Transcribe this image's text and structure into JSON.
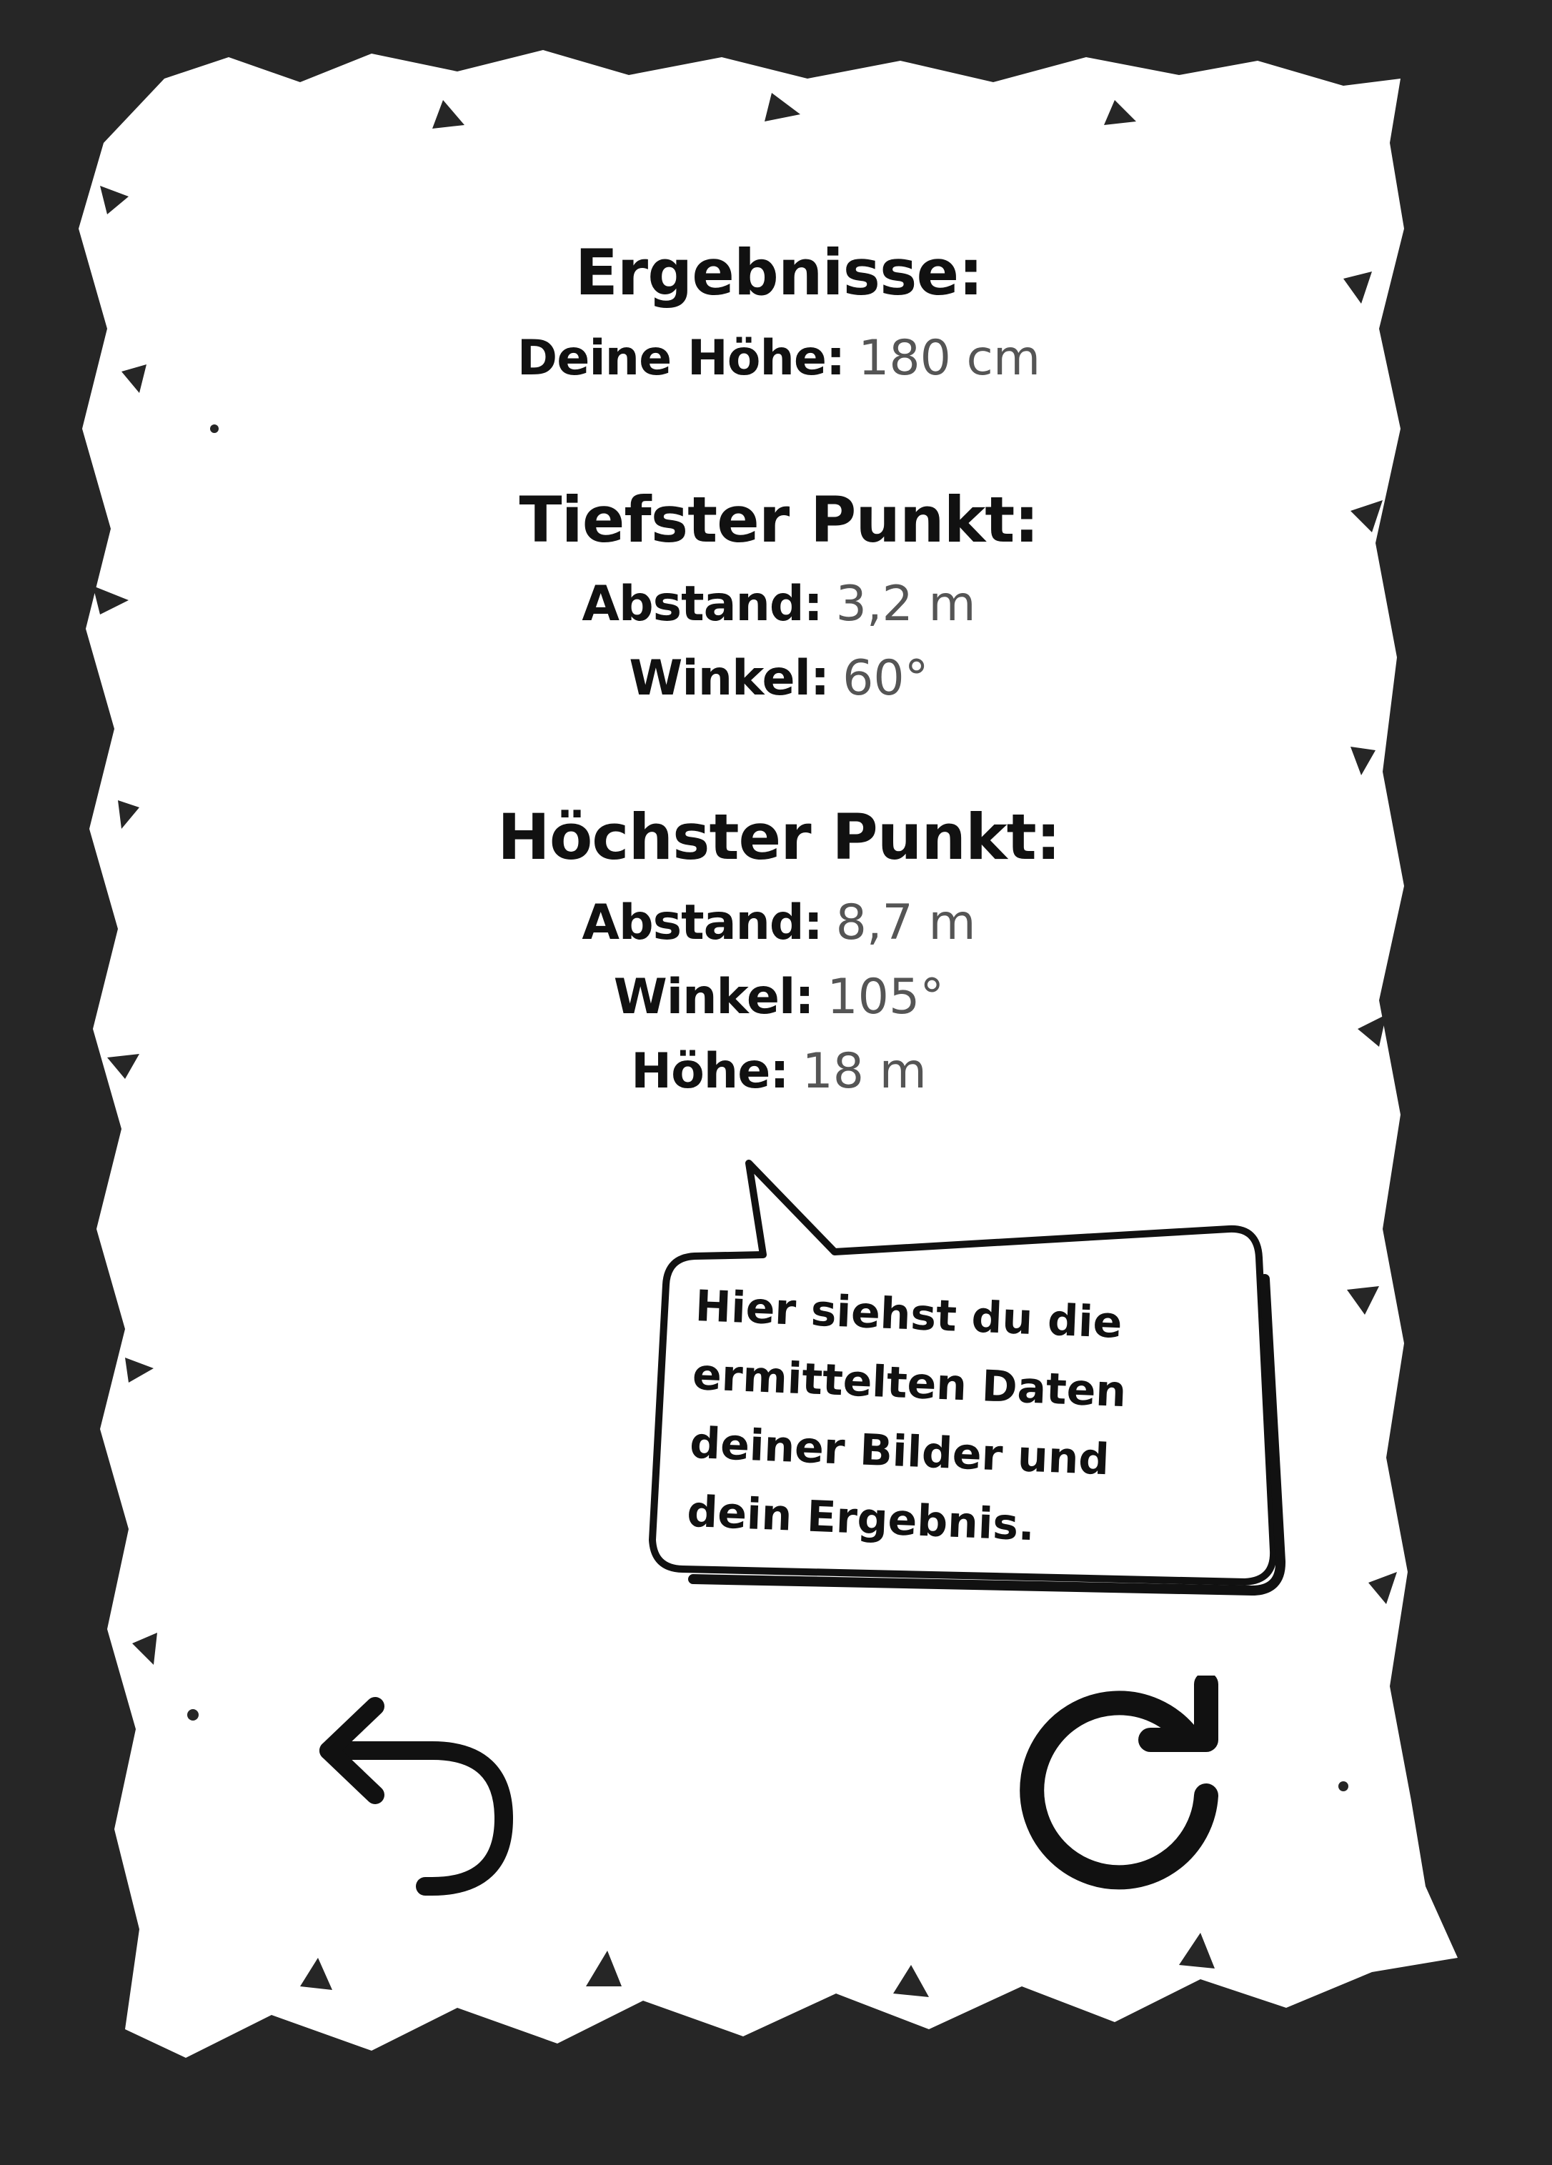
{
  "results": {
    "title": "Ergebnisse:",
    "height_label": "Deine Höhe:",
    "height_value": "180 cm"
  },
  "lowest_point": {
    "title": "Tiefster Punkt:",
    "distance_label": "Abstand:",
    "distance_value": "3,2 m",
    "angle_label": "Winkel:",
    "angle_value": "60°"
  },
  "highest_point": {
    "title": "Höchster Punkt:",
    "distance_label": "Abstand:",
    "distance_value": "8,7 m",
    "angle_label": "Winkel:",
    "angle_value": "105°",
    "height_label": "Höhe:",
    "height_value": "18 m"
  },
  "speech_bubble": {
    "lines": [
      "Hier siehst du die",
      "ermittelten Daten",
      "deiner Bilder und",
      "dein Ergebnis."
    ]
  },
  "icons": {
    "back": "undo-arrow-icon",
    "restart": "reload-icon"
  },
  "colors": {
    "background": "#262626",
    "paper": "#ffffff",
    "label": "#111111",
    "value": "#555555"
  }
}
